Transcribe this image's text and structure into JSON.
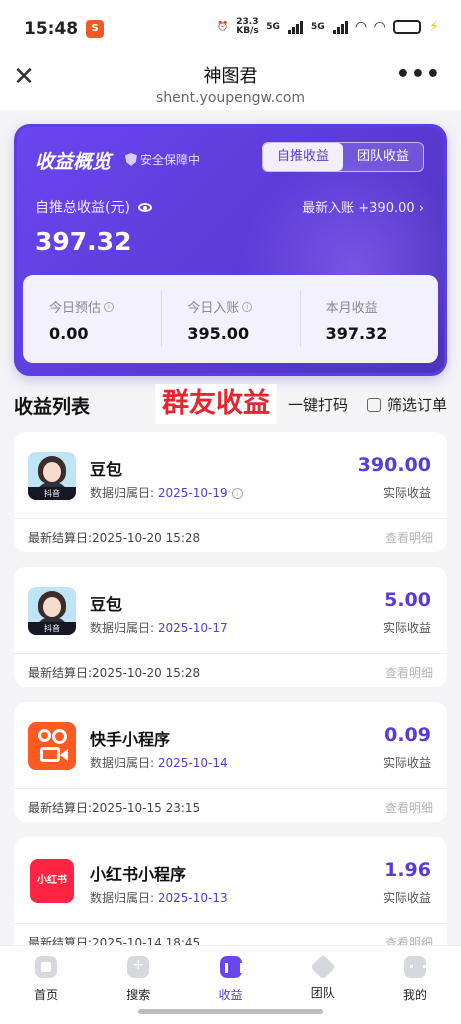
{
  "status_bar": {
    "time": "15:48",
    "app_badge": "S",
    "net_speed": "23.3 KB/s",
    "sig1": "5G",
    "sig2": "5G"
  },
  "header": {
    "title": "神图君",
    "url": "shent.youpengw.com"
  },
  "summary": {
    "title": "收益概览",
    "safe_label": "安全保障中",
    "tabs": [
      "自推收益",
      "团队收益"
    ],
    "total_label": "自推总收益(元)",
    "latest": "最新入账 +390.00",
    "total_value": "397.32",
    "stats": [
      {
        "label": "今日预估",
        "value": "0.00"
      },
      {
        "label": "今日入账",
        "value": "395.00"
      },
      {
        "label": "本月收益",
        "value": "397.32"
      }
    ]
  },
  "list": {
    "title": "收益列表",
    "overlay_tag": "群友收益",
    "print_label": "一键打码",
    "filter_label": "筛选订单",
    "date_prefix": "数据归属日:",
    "amount_label": "实际收益",
    "detail_label": "查看明细",
    "items": [
      {
        "name": "豆包",
        "date": "2025-10-19",
        "amount": "390.00",
        "settle": "最新结算日:2025-10-20 15:28",
        "platform": "抖音"
      },
      {
        "name": "豆包",
        "date": "2025-10-17",
        "amount": "5.00",
        "settle": "最新结算日:2025-10-20 15:28",
        "platform": "抖音"
      },
      {
        "name": "快手小程序",
        "date": "2025-10-14",
        "amount": "0.09",
        "settle": "最新结算日:2025-10-15 23:15"
      },
      {
        "name": "小红书小程序",
        "date": "2025-10-13",
        "amount": "1.96",
        "settle": "最新结算日:2025-10-14 18:45",
        "logo_text": "小红书"
      }
    ]
  },
  "nav": [
    "首页",
    "搜索",
    "收益",
    "团队",
    "我的"
  ]
}
